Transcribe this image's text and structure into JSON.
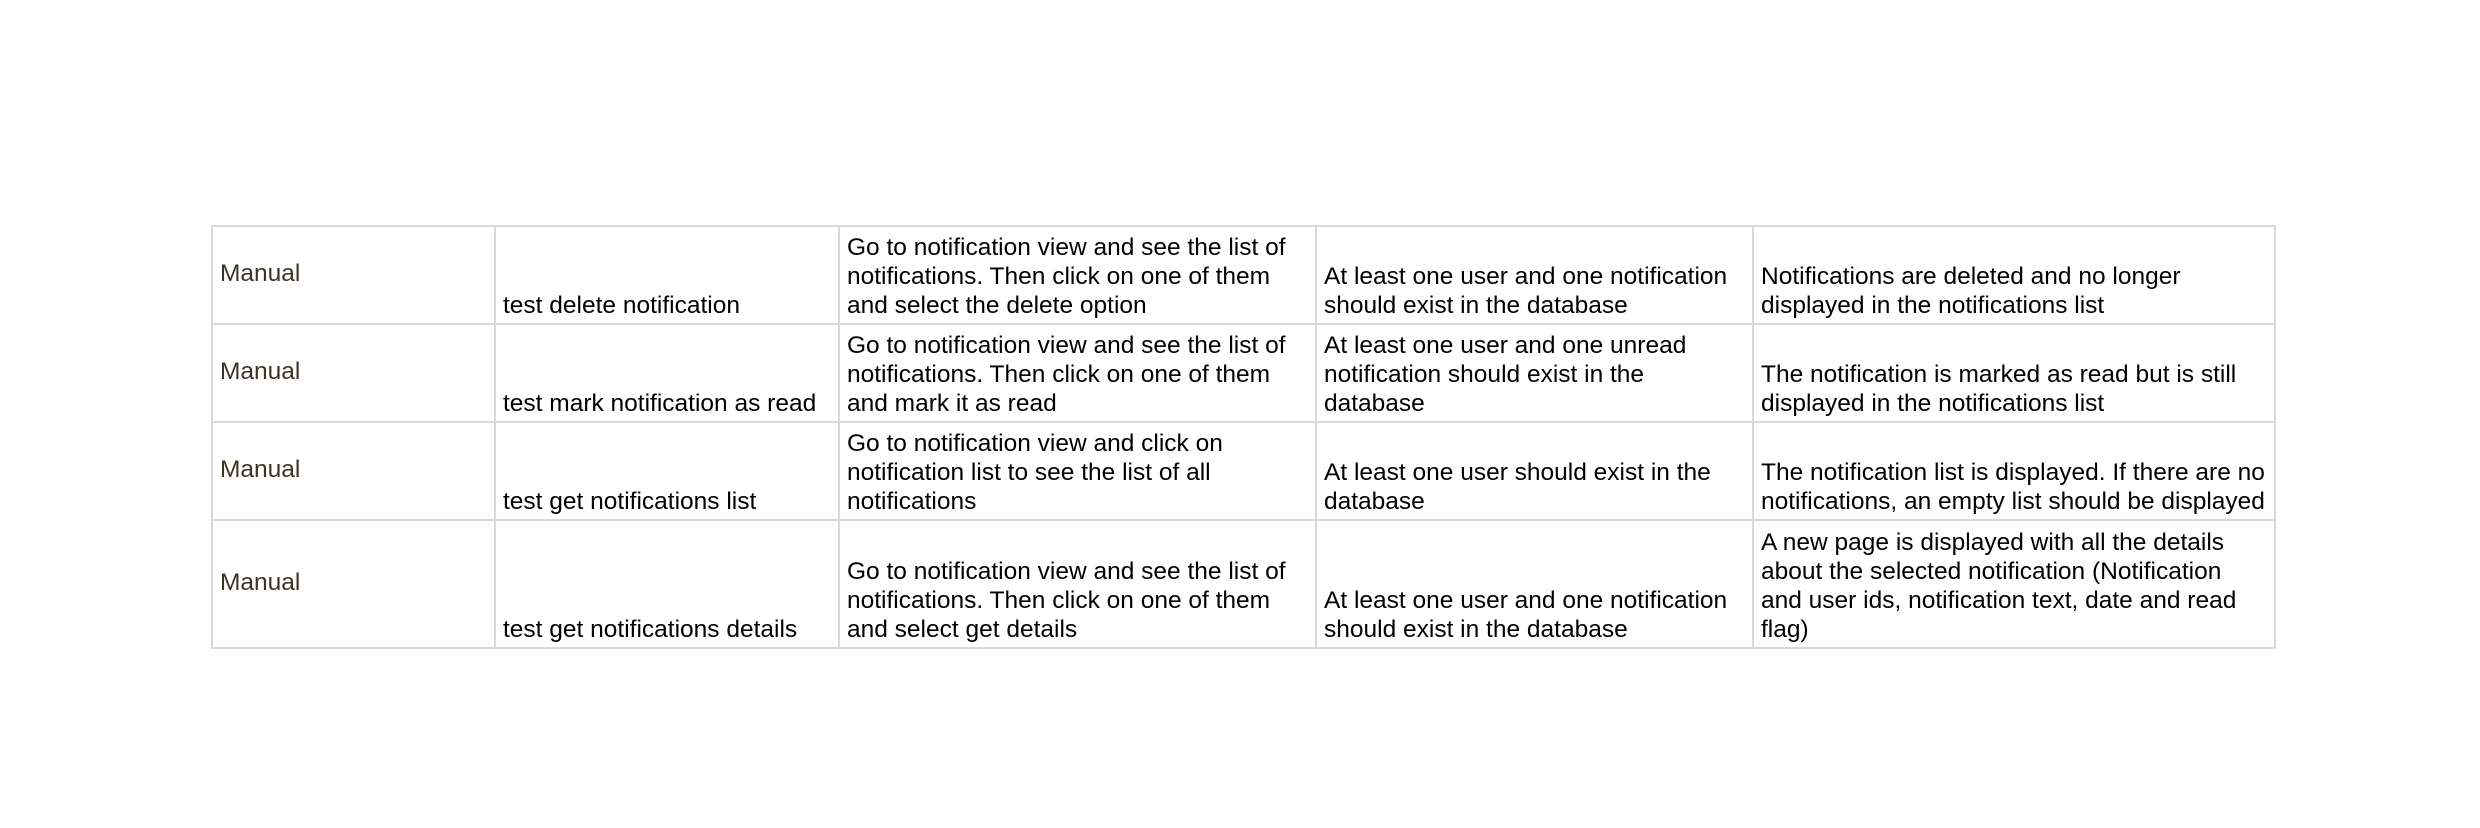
{
  "table": {
    "rows": [
      {
        "type": "Manual",
        "name": "test delete notification",
        "steps": "Go to notification view and see the list of notifications. Then click on one of them and select the delete option",
        "precondition": "At least one user and one notification should exist in the database",
        "expected": "Notifications are deleted and no longer displayed in the notifications list"
      },
      {
        "type": "Manual",
        "name": "test mark notification as read",
        "steps": "Go to notification view and see the list of notifications. Then click on one of them and mark it as read",
        "precondition": "At least one user and one unread notification should exist in the database",
        "expected": "The notification is marked as read but is still displayed in the notifications list"
      },
      {
        "type": "Manual",
        "name": "test get notifications list",
        "steps": "Go to notification view and click on notification list to see the list of all notifications",
        "precondition": "At least one user should exist in the database",
        "expected": "The notification list is displayed. If there are no notifications, an empty list should be displayed"
      },
      {
        "type": "Manual",
        "name": "test get notifications details",
        "steps": "Go to notification view and see the list of notifications. Then click on one of them and select get details",
        "precondition": "At least one user and one notification should exist in the database",
        "expected": "A new page is displayed with all the details about the selected notification (Notification and user ids, notification text, date and read flag)"
      }
    ]
  }
}
